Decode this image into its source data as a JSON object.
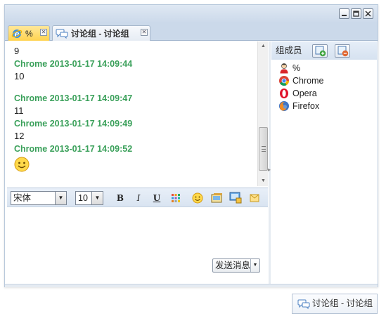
{
  "tabs": [
    {
      "label": "%",
      "icon": "ie-icon",
      "active": true
    },
    {
      "label": "讨论组 - 讨论组",
      "icon": "discussion-icon",
      "active": false
    }
  ],
  "chat": {
    "lines": [
      {
        "kind": "text",
        "text": "9"
      },
      {
        "kind": "sender",
        "text": "Chrome 2013-01-17 14:09:44"
      },
      {
        "kind": "text",
        "text": "10"
      },
      {
        "kind": "sender",
        "text": "Chrome 2013-01-17 14:09:47"
      },
      {
        "kind": "text",
        "text": "11"
      },
      {
        "kind": "sender",
        "text": "Chrome 2013-01-17 14:09:49"
      },
      {
        "kind": "text",
        "text": "12"
      },
      {
        "kind": "sender",
        "text": "Chrome 2013-01-17 14:09:52"
      }
    ],
    "sender_color": "#3aa05a"
  },
  "toolbar": {
    "font_family": "宋体",
    "font_size": "10",
    "bold_label": "B",
    "italic_label": "I",
    "underline_label": "U"
  },
  "send": {
    "label": "发送消息"
  },
  "members": {
    "title": "组成员",
    "list": [
      {
        "name": "%",
        "icon": "person-icon"
      },
      {
        "name": "Chrome",
        "icon": "chrome-icon"
      },
      {
        "name": "Opera",
        "icon": "opera-icon"
      },
      {
        "name": "Firefox",
        "icon": "firefox-icon"
      }
    ]
  },
  "taskbar": {
    "label": "讨论组 - 讨论组"
  },
  "colors": {
    "titlebar": "#cbd9ea",
    "active_tab": "#ffd34f"
  }
}
